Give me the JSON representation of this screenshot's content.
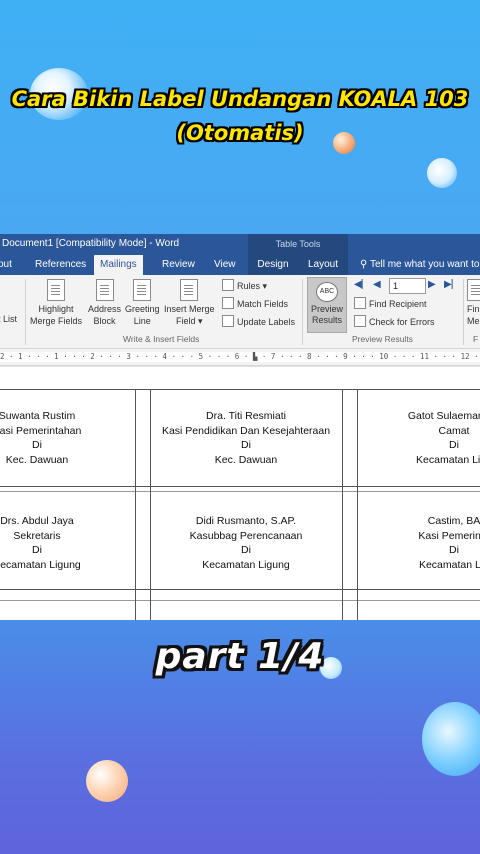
{
  "overlay": {
    "title_line1": "Cara Bikin Label Undangan KOALA 103",
    "title_line2": "(Otomatis)",
    "part_label": "part  1/4"
  },
  "colors": {
    "title_yellow": "#ffe600",
    "word_blue": "#2b579a",
    "bg_top": "#3fb0f5",
    "bg_bottom": "#5f63dc"
  },
  "word": {
    "window_title": "Document1 [Compatibility Mode] - Word",
    "contextual_group": "Table Tools",
    "tabs": {
      "layout_left": "out",
      "references": "References",
      "mailings": "Mailings",
      "review": "Review",
      "view": "View",
      "design": "Design",
      "layout": "Layout"
    },
    "tell_me": "Tell me what you want to",
    "ribbon": {
      "edit_list": "t List",
      "highlight_1": "Highlight",
      "highlight_2": "Merge Fields",
      "address_1": "Address",
      "address_2": "Block",
      "greeting_1": "Greeting",
      "greeting_2": "Line",
      "insert_merge_1": "Insert Merge",
      "insert_merge_2": "Field",
      "rules": "Rules",
      "match_fields": "Match Fields",
      "update_labels": "Update Labels",
      "group_write_insert": "Write & Insert Fields",
      "preview_1": "Preview",
      "preview_2": "Results",
      "preview_icon": "ABC",
      "record_value": "1",
      "find_recipient": "Find Recipient",
      "check_errors": "Check for Errors",
      "group_preview": "Preview Results",
      "finish_1": "Fin",
      "finish_2": "Me",
      "finish_group": "F"
    },
    "ruler_text": "2 · 1 · · · 1 · · · 2 · · · 3 · · · 4 · · · 5 · · · 6 · ▙ · 7 · · · 8 · · · 9 · · · 10 · · · 11 · · · 12 · · · 13 ▙ · 14 · · · 15 · · · 16 · · · 17 · · ·"
  },
  "labels": [
    {
      "lines": [
        "Suwanta Rustim",
        "Kasi Pemerintahan",
        "Di",
        "Kec. Dawuan"
      ]
    },
    {
      "lines": [
        "Dra. Titi Resmiati",
        "Kasi Pendidikan Dan Kesejahteraan",
        "Di",
        "Kec. Dawuan"
      ]
    },
    {
      "lines": [
        "Gatot Sulaeman AP",
        "Camat",
        "Di",
        "Kecamatan Ligu"
      ]
    },
    {
      "lines": [
        "Drs. Abdul Jaya",
        "Sekretaris",
        "Di",
        "Kecamatan Ligung"
      ]
    },
    {
      "lines": [
        "Didi Rusmanto, S.AP.",
        "Kasubbag Perencanaan",
        "Di",
        "Kecamatan Ligung"
      ]
    },
    {
      "lines": [
        "Castim, BA",
        "Kasi Pemerinta",
        "Di",
        "Kecamatan Lig"
      ]
    }
  ]
}
